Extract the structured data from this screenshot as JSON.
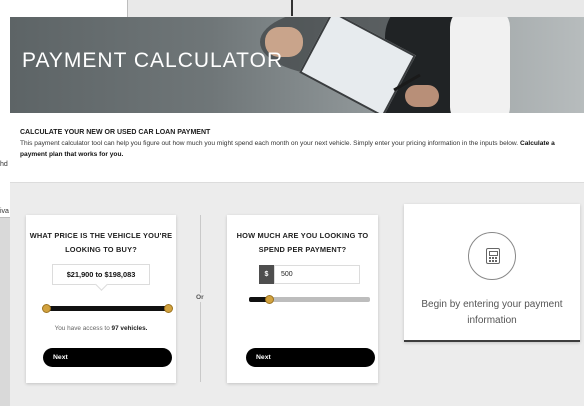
{
  "background": {
    "fragment_1": "hd",
    "fragment_2": "iva"
  },
  "header": {
    "title": "PAYMENT CALCULATOR"
  },
  "intro": {
    "heading": "CALCULATE YOUR NEW OR USED CAR LOAN PAYMENT",
    "body": "This payment calculator tool can help you figure out how much you might spend each month on your next vehicle. Simply enter your pricing information in the inputs below. ",
    "body_bold": "Calculate a payment plan that works for you."
  },
  "price_panel": {
    "question": "WHAT PRICE IS THE VEHICLE YOU'RE LOOKING TO BUY?",
    "range_label": "$21,900 to $198,083",
    "slider": {
      "min_fraction": 0.0,
      "max_fraction": 1.0
    },
    "access_prefix": "You have access to ",
    "vehicle_count": "97 vehicles.",
    "next_label": "Next"
  },
  "separator": {
    "or_label": "Or"
  },
  "payment_panel": {
    "question": "HOW MUCH ARE YOU LOOKING TO SPEND PER PAYMENT?",
    "currency_symbol": "$",
    "amount_value": "500",
    "slider": {
      "fraction": 0.17
    },
    "next_label": "Next"
  },
  "result_panel": {
    "icon": "calculator-icon",
    "message": "Begin by entering your payment information"
  },
  "colors": {
    "accent": "#d2a23e",
    "button": "#000000"
  }
}
